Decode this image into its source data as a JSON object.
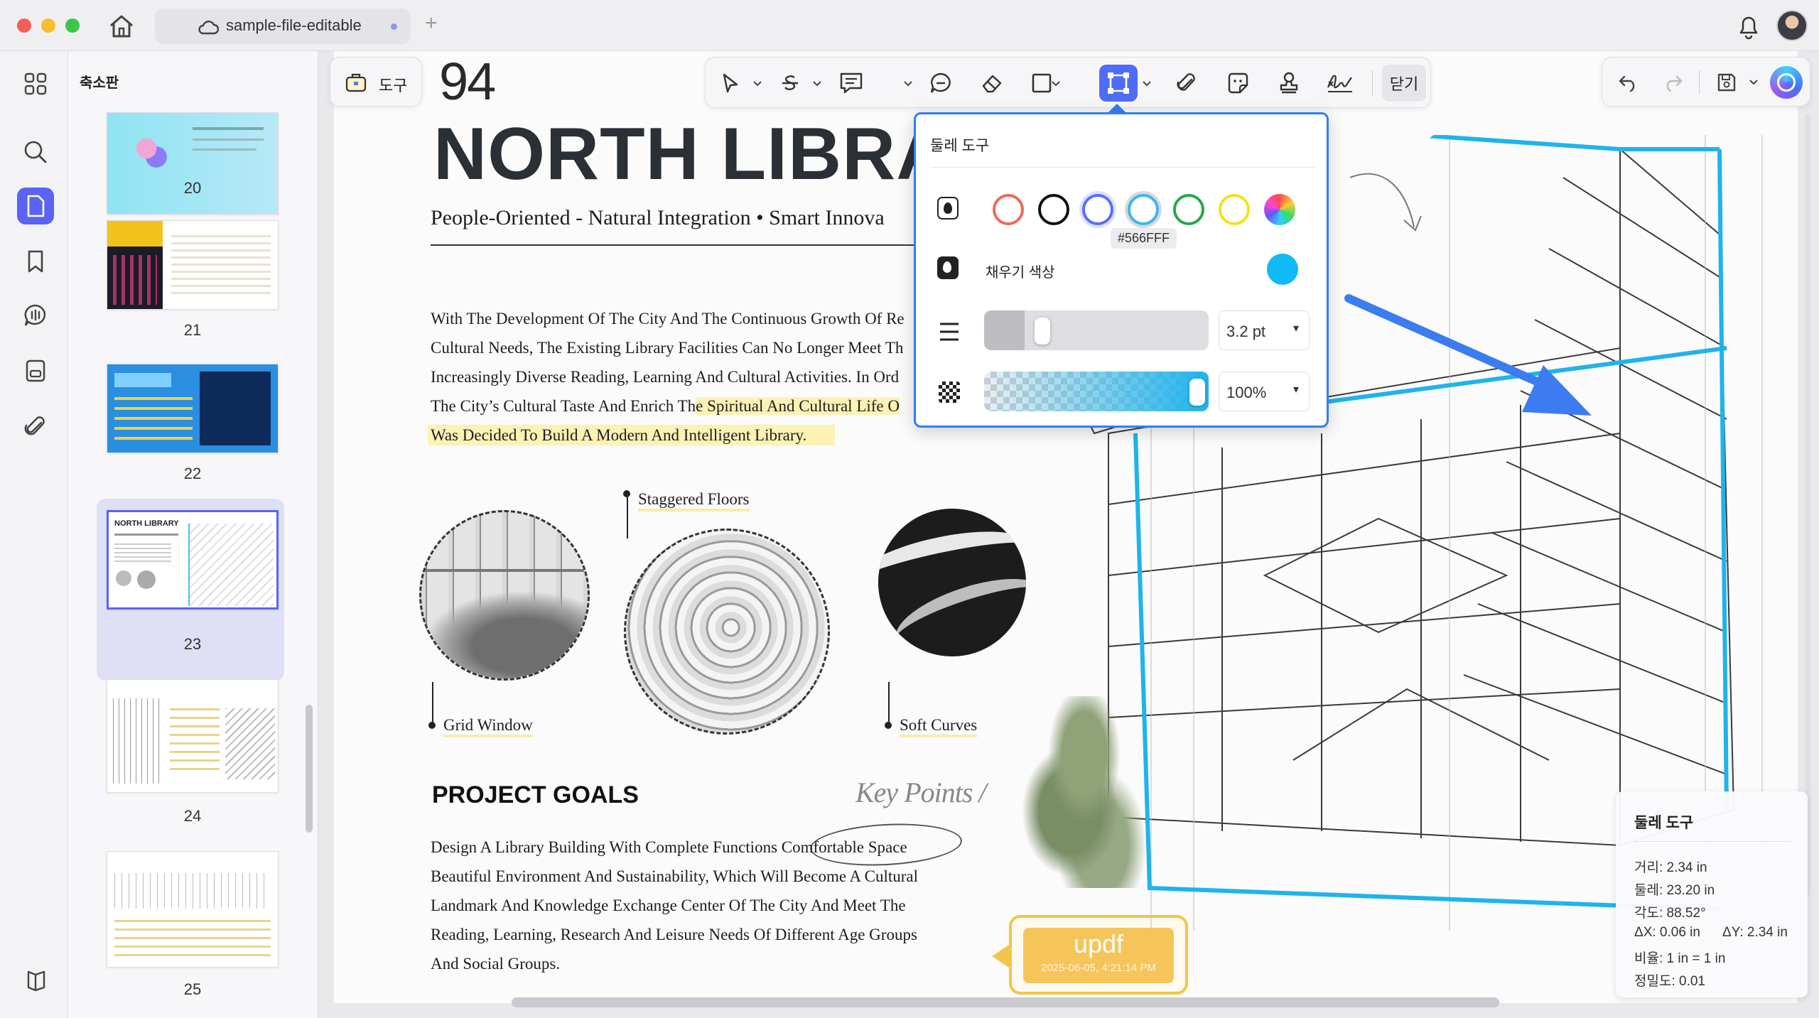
{
  "titlebar": {
    "tab_title": "sample-file-editable"
  },
  "thumbnails": {
    "panel_title": "축소판",
    "pages": [
      "20",
      "21",
      "22",
      "23",
      "24",
      "25"
    ]
  },
  "toolbar": {
    "tools_label": "도구",
    "close_label": "닫기"
  },
  "document": {
    "page_number": "94",
    "title": "NORTH LIBRA",
    "subtitle": "People-Oriented - Natural Integration • Smart Innova",
    "intro_lines": [
      "With The Development Of The City And The Continuous Growth Of Re",
      "Cultural Needs, The Existing Library Facilities Can No Longer Meet Th",
      "Increasingly Diverse Reading, Learning And Cultural Activities. In Ord",
      "The City’s Cultural Taste And Enrich Th",
      "e Spiritual And Cultural Life O",
      "Was Decided To Build A Modern And Intelligent Library."
    ],
    "labels": {
      "staggered": "Staggered Floors",
      "grid": "Grid Window",
      "soft": "Soft Curves"
    },
    "goals_heading": "PROJECT GOALS",
    "handwriting": "Key Points /",
    "goals_lines": [
      "Design A Library Building With Complete Functions Comfortable Space",
      "Beautiful Environment And Sustainability, Which Will Become A Cultural",
      "Landmark And Knowledge Exchange Center Of The City And Meet The",
      "Reading, Learning, Research And Leisure Needs Of Different Age Groups",
      "And Social Groups."
    ],
    "stamp": {
      "text": "updf",
      "date": "2025-06-05, 4:21:14 PM"
    }
  },
  "popover": {
    "title": "둘레 도구",
    "swatches": [
      {
        "name": "red",
        "color": "#f06a5a"
      },
      {
        "name": "black",
        "color": "#111111"
      },
      {
        "name": "blue",
        "color": "#566FFF"
      },
      {
        "name": "cyan",
        "color": "#3fb6e8"
      },
      {
        "name": "green",
        "color": "#25a84a"
      },
      {
        "name": "yellow",
        "color": "#f2e21d"
      }
    ],
    "tooltip": "#566FFF",
    "fill_label": "채우기 색상",
    "fill_color": "#10baf5",
    "stroke_value": "3.2 pt",
    "stroke_level": 0.18,
    "opacity_value": "100%",
    "opacity_level": 1.0
  },
  "measure": {
    "title": "둘레 도구",
    "distance": "거리: 2.34 in",
    "perimeter": "둘레: 23.20 in",
    "angle": "각도: 88.52°",
    "dx": "ΔX: 0.06 in",
    "dy": "ΔY: 2.34 in",
    "scale": "비율: 1 in = 1 in",
    "precision": "정밀도: 0.01"
  },
  "colors": {
    "accent": "#2f7ff2",
    "selection": "#566FFF",
    "highlight": "#fbf2b4",
    "perimeter_line": "#1fb3ec"
  }
}
